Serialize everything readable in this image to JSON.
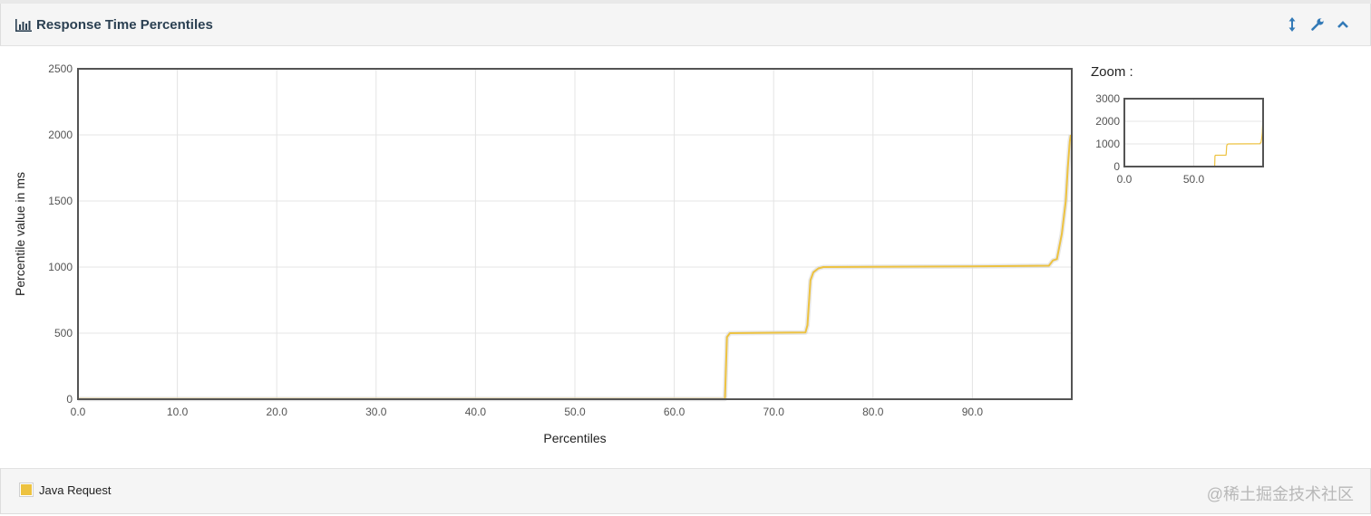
{
  "panel": {
    "title": "Response Time Percentiles",
    "icons": {
      "header": "bar-chart-icon",
      "resize": "vertical-resize-icon",
      "settings": "wrench-icon",
      "collapse": "chevron-up-icon"
    }
  },
  "zoom": {
    "label": "Zoom :",
    "y_ticks": [
      0,
      1000,
      2000,
      3000
    ],
    "ylim": [
      0,
      3000
    ],
    "x_ticks": [
      "0.0",
      "50.0"
    ],
    "xlim": [
      0,
      100
    ]
  },
  "legend": {
    "items": [
      {
        "label": "Java Request",
        "color": "#edc240"
      }
    ]
  },
  "watermark": "@稀土掘金技术社区",
  "chart_data": {
    "type": "line",
    "title": "",
    "xlabel": "Percentiles",
    "ylabel": "Percentile value in ms",
    "xlim": [
      0,
      100
    ],
    "ylim": [
      0,
      2500
    ],
    "x_ticks": [
      "0.0",
      "10.0",
      "20.0",
      "30.0",
      "40.0",
      "50.0",
      "60.0",
      "70.0",
      "80.0",
      "90.0"
    ],
    "y_ticks": [
      "0",
      "500",
      "1000",
      "1500",
      "2000",
      "2500"
    ],
    "grid": true,
    "legend_position": "bottom-left",
    "series": [
      {
        "name": "Java Request",
        "color": "#edc240",
        "x": [
          0,
          65.1,
          65.3,
          65.6,
          73.2,
          73.4,
          73.7,
          74.0,
          74.5,
          75.0,
          90.0,
          97.7,
          98.1,
          98.5,
          99.0,
          99.4,
          99.6,
          99.8,
          99.9
        ],
        "y": [
          2,
          2,
          470,
          500,
          505,
          560,
          900,
          960,
          990,
          1000,
          1005,
          1010,
          1050,
          1060,
          1250,
          1500,
          1750,
          1950,
          2000
        ]
      }
    ]
  }
}
